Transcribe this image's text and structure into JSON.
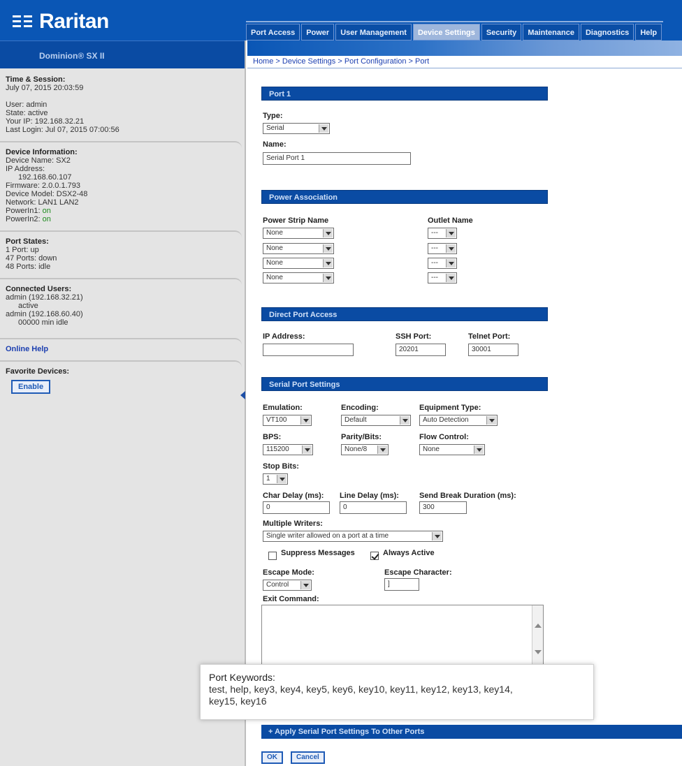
{
  "brand": {
    "name": "Raritan",
    "product": "Dominion® SX II"
  },
  "nav": {
    "tabs": [
      "Port Access",
      "Power",
      "User Management",
      "Device Settings",
      "Security",
      "Maintenance",
      "Diagnostics",
      "Help"
    ],
    "active": "Device Settings"
  },
  "breadcrumb": "Home > Device Settings > Port Configuration > Port",
  "sidebar": {
    "session": {
      "title": "Time & Session:",
      "datetime": "July 07, 2015 20:03:59",
      "user": "User: admin",
      "state": "State: active",
      "your_ip": "Your IP: 192.168.32.21",
      "last_login": "Last Login: Jul 07, 2015 07:00:56"
    },
    "device": {
      "title": "Device Information:",
      "name": "Device Name: SX2",
      "ip_label": "IP Address:",
      "ip": "192.168.60.107",
      "firmware": "Firmware: 2.0.0.1.793",
      "model": "Device Model: DSX2-48",
      "network": "Network: LAN1 LAN2",
      "power1_label": "PowerIn1:",
      "power1": "on",
      "power2_label": "PowerIn2:",
      "power2": "on"
    },
    "ports": {
      "title": "Port States:",
      "up": "1 Port: up",
      "down": "47 Ports: down",
      "idle": "48 Ports: idle"
    },
    "users": {
      "title": "Connected Users:",
      "u1": "admin (192.168.32.21)",
      "u1_state": "active",
      "u2": "admin (192.168.60.40)",
      "u2_state": "00000 min idle"
    },
    "online_help": "Online Help",
    "favorites": {
      "title": "Favorite Devices:",
      "button": "Enable"
    }
  },
  "port": {
    "section": "Port 1",
    "type_label": "Type:",
    "type_value": "Serial",
    "name_label": "Name:",
    "name_value": "Serial Port 1"
  },
  "power_assoc": {
    "section": "Power Association",
    "strip_label": "Power Strip Name",
    "outlet_label": "Outlet Name",
    "strips": [
      "None",
      "None",
      "None",
      "None"
    ],
    "outlets": [
      "---",
      "---",
      "---",
      "---"
    ]
  },
  "direct_access": {
    "section": "Direct Port Access",
    "ip_label": "IP Address:",
    "ip_value": "",
    "ssh_label": "SSH Port:",
    "ssh_value": "20201",
    "telnet_label": "Telnet Port:",
    "telnet_value": "30001"
  },
  "serial": {
    "section": "Serial Port Settings",
    "emulation_label": "Emulation:",
    "emulation_value": "VT100",
    "encoding_label": "Encoding:",
    "encoding_value": "Default",
    "equipment_label": "Equipment Type:",
    "equipment_value": "Auto Detection",
    "bps_label": "BPS:",
    "bps_value": "115200",
    "parity_label": "Parity/Bits:",
    "parity_value": "None/8",
    "flow_label": "Flow Control:",
    "flow_value": "None",
    "stop_label": "Stop Bits:",
    "stop_value": "1",
    "char_delay_label": "Char Delay (ms):",
    "char_delay_value": "0",
    "line_delay_label": "Line Delay (ms):",
    "line_delay_value": "0",
    "break_label": "Send Break Duration (ms):",
    "break_value": "300",
    "writers_label": "Multiple Writers:",
    "writers_value": "Single writer allowed on a port at a time",
    "suppress_label": "Suppress Messages",
    "always_active_label": "Always Active",
    "escape_mode_label": "Escape Mode:",
    "escape_mode_value": "Control",
    "escape_char_label": "Escape Character:",
    "escape_char_value": "]",
    "exit_label": "Exit Command:"
  },
  "apply_section": "Apply Serial Port Settings To Other Ports",
  "buttons": {
    "ok": "OK",
    "cancel": "Cancel"
  },
  "keywords_popup": {
    "title": "Port Keywords:",
    "line1": "test, help, key3, key4, key5, key6, key10, key11, key12, key13, key14,",
    "line2": "key15, key16"
  }
}
